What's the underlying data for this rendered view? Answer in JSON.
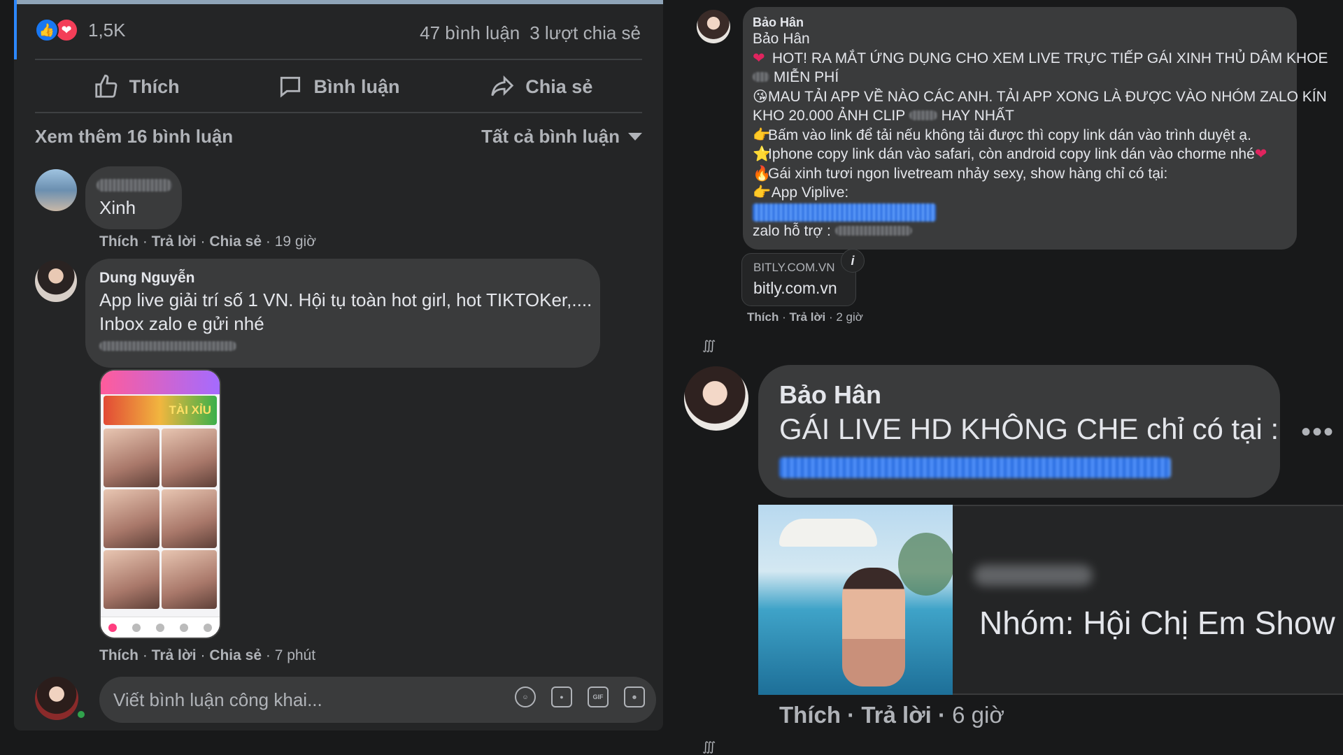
{
  "post": {
    "reaction_count": "1,5K",
    "comments_count": "47 bình luận",
    "shares_count": "3 lượt chia sẻ",
    "actions": {
      "like": "Thích",
      "comment": "Bình luận",
      "share": "Chia sẻ"
    },
    "view_more": "Xem thêm 16 bình luận",
    "filter": "Tất cả bình luận"
  },
  "comments": [
    {
      "text": "Xinh",
      "actions": [
        "Thích",
        "Trả lời",
        "Chia sẻ"
      ],
      "time": "19 giờ"
    },
    {
      "author": "Dung Nguyễn",
      "text_line1": "App live giải trí số 1 VN. Hội tụ toàn hot girl, hot TIKTOKer,....",
      "text_line2": "Inbox zalo e gửi nhé",
      "phone_banner": "TÀI XỈU",
      "actions": [
        "Thích",
        "Trả lời",
        "Chia sẻ"
      ],
      "time": "7 phút"
    }
  ],
  "composer": {
    "placeholder": "Viết bình luận công khai...",
    "gif_label": "GIF"
  },
  "right": {
    "comment1": {
      "author_small": "Bảo Hân",
      "author": "Bảo Hân",
      "lines": [
        "HOT! RA MẮT ỨNG DỤNG CHO XEM LIVE TRỰC TIẾP GÁI XINH THỦ DÂM KHOE",
        "MIỄN PHÍ",
        "MAU TẢI APP VỀ NÀO CÁC ANH. TẢI APP XONG LÀ ĐƯỢC VÀO NHÓM ZALO KÍN",
        "KHO 20.000 ẢNH CLIP",
        "HAY NHẤT",
        "Bấm vào link để tải nếu không tải được thì copy link dán vào trình duyệt ạ.",
        "Iphone copy link dán vào safari, còn android copy link dán vào chorme nhé",
        "Gái xinh tươi ngon livetream nhảy sexy, show hàng chỉ có tại:",
        "App Viplive:",
        "zalo hỗ trợ :"
      ],
      "emojis": [
        "❤",
        "😘",
        "👉",
        "⭐",
        "🔥",
        "👉"
      ],
      "preview_domain": "BITLY.COM.VN",
      "preview_host": "bitly.com.vn",
      "info_icon": "i",
      "meta_like": "Thích",
      "meta_reply": "Trả lời",
      "meta_time": "2 giờ"
    },
    "comment2": {
      "author": "Bảo Hân",
      "text": "GÁI LIVE HD KHÔNG CHE chỉ có tại :",
      "group_name": "Nhóm: Hội Chị Em Show",
      "meta_like": "Thích",
      "meta_reply": "Trả lời",
      "meta_time": "6 giờ"
    }
  }
}
